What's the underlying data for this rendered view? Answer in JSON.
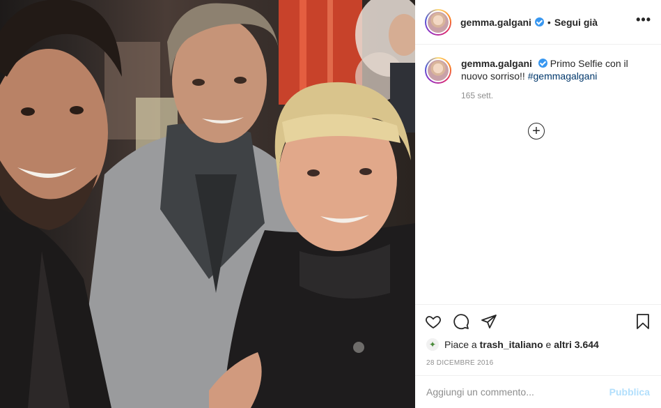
{
  "post": {
    "image_alt": "Selfie of three people",
    "author": {
      "username": "gemma.galgani",
      "verified": true,
      "follow_status": "Segui già"
    },
    "header_separator": "•",
    "more_label": "•••",
    "caption": {
      "username": "gemma.galgani",
      "text": "Primo Selfie con il nuovo sorriso!!",
      "hashtag": "#gemmagalgani",
      "time": "165 sett."
    },
    "load_more_label": "+",
    "likes": {
      "prefix": "Piace a",
      "user": "trash_italiano",
      "connector": "e",
      "others": "altri 3.644"
    },
    "date": "28 DICEMBRE 2016",
    "comment": {
      "placeholder": "Aggiungi un commento...",
      "value": "",
      "publish_label": "Pubblica"
    }
  },
  "icons": {
    "like": "heart-icon",
    "comment": "comment-icon",
    "share": "share-icon",
    "save": "bookmark-icon",
    "more": "more-options-icon",
    "load_more": "plus-circle-icon",
    "verified": "verified-badge-icon"
  },
  "colors": {
    "accent_link": "#00376b",
    "verified": "#3897f0",
    "publish_disabled": "#b2dffc",
    "muted_text": "#8e8e8e"
  }
}
